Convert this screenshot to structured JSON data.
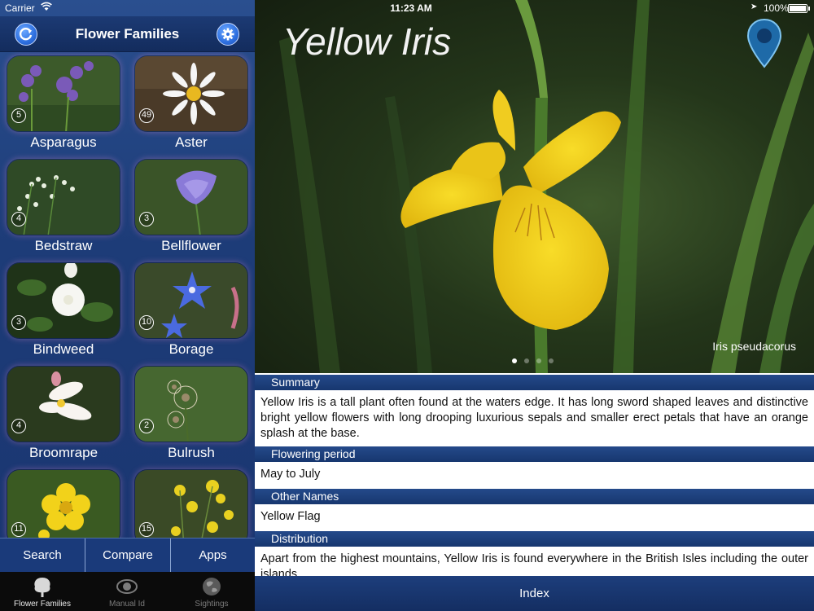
{
  "status_bar": {
    "carrier": "Carrier",
    "time": "11:23 AM",
    "battery": "100%"
  },
  "left": {
    "title": "Flower Families",
    "tiles": [
      {
        "name": "Asparagus",
        "count": "5"
      },
      {
        "name": "Aster",
        "count": "49"
      },
      {
        "name": "Bedstraw",
        "count": "4"
      },
      {
        "name": "Bellflower",
        "count": "3"
      },
      {
        "name": "Bindweed",
        "count": "3"
      },
      {
        "name": "Borage",
        "count": "10"
      },
      {
        "name": "Broomrape",
        "count": "4"
      },
      {
        "name": "Bulrush",
        "count": "2"
      },
      {
        "name": "",
        "count": "11"
      },
      {
        "name": "",
        "count": "15"
      }
    ],
    "segments": [
      "Search",
      "Compare",
      "Apps"
    ],
    "tabs": [
      {
        "label": "Flower Families",
        "active": true
      },
      {
        "label": "Manual Id",
        "active": false
      },
      {
        "label": "Sightings",
        "active": false
      }
    ]
  },
  "right": {
    "title": "Yellow Iris",
    "latin_name": "Iris pseudacorus",
    "sections": [
      {
        "heading": "Summary",
        "body": "Yellow Iris is a tall plant often found at the waters edge. It has long sword shaped leaves and distinctive bright yellow flowers with long drooping luxurious sepals and smaller erect petals that have an orange splash at the base."
      },
      {
        "heading": "Flowering period",
        "body": "May to July"
      },
      {
        "heading": "Other Names",
        "body": "Yellow Flag"
      },
      {
        "heading": "Distribution",
        "body": "Apart from the highest mountains, Yellow Iris is found everywhere in the British Isles including the outer islands."
      }
    ],
    "index_label": "Index"
  },
  "colors": {
    "nav_blue": "#1c3a74",
    "accent_blue": "#2d6fe0",
    "iris_yellow": "#f2d21a"
  }
}
